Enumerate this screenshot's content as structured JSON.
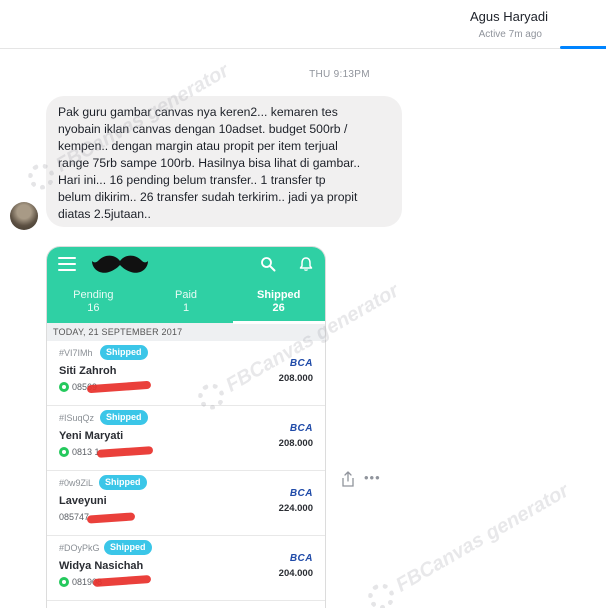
{
  "conversation": {
    "contact_name": "Agus Haryadi",
    "contact_status": "Active 7m ago",
    "timestamp": "THU 9:13PM",
    "message_text": "Pak guru gambar canvas nya keren2... kemaren tes\nnyobain iklan canvas dengan 10adset.  budget 500rb /\nkempen.. dengan margin atau propit per item terjual\nrange 75rb sampe 100rb. Hasilnya bisa lihat di gambar..\nHari ini... 16 pending belum transfer.. 1 transfer tp\nbelum dikirim.. 26 transfer sudah terkirim.. jadi ya propit\ndiatas 2.5jutaan.."
  },
  "screenshot_app": {
    "tabs": [
      {
        "label": "Pending",
        "count": "16"
      },
      {
        "label": "Paid",
        "count": "1"
      },
      {
        "label": "Shipped",
        "count": "26"
      }
    ],
    "active_tab": "Shipped",
    "date_header": "TODAY, 21 SEPTEMBER 2017",
    "orders": [
      {
        "code": "#VI7IMh",
        "status": "Shipped",
        "buyer": "Siti Zahroh",
        "phone": "08569",
        "bank": "BCA",
        "amount": "208.000"
      },
      {
        "code": "#ISuqQz",
        "status": "Shipped",
        "buyer": "Yeni Maryati",
        "phone": "0813 1",
        "bank": "BCA",
        "amount": "208.000"
      },
      {
        "code": "#0w9ZiL",
        "status": "Shipped",
        "buyer": "Laveyuni",
        "phone": "085747",
        "bank": "BCA",
        "amount": "224.000"
      },
      {
        "code": "#DOyPkG",
        "status": "Shipped",
        "buyer": "Widya Nasichah",
        "phone": "081908",
        "bank": "BCA",
        "amount": "204.000"
      }
    ]
  },
  "watermark": {
    "text": "FBCanvas generator"
  },
  "colors": {
    "app_accent": "#2fd0a4",
    "badge": "#3bc6e8",
    "messenger_blue": "#0084ff",
    "redaction": "#e8302a"
  }
}
